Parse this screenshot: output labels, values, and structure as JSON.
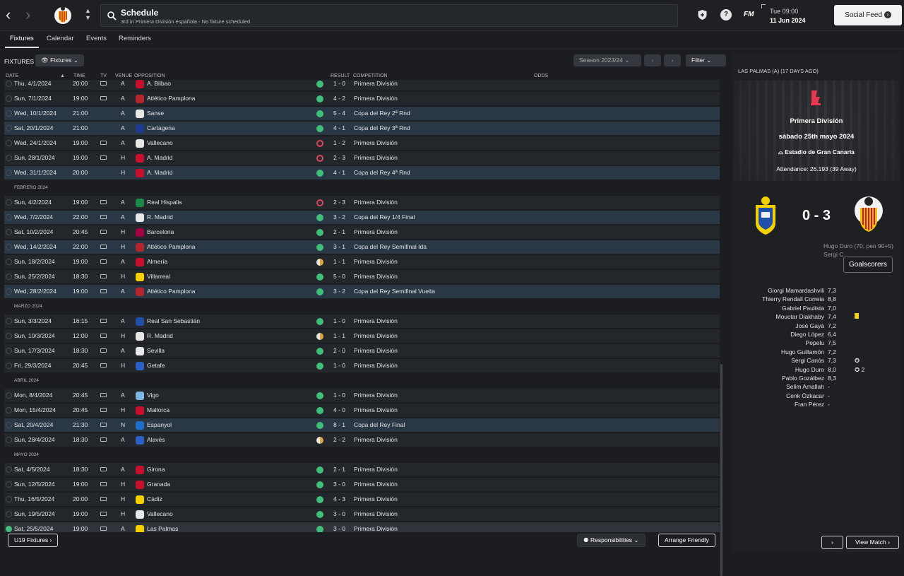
{
  "nav": {
    "back": "‹",
    "forward": "›"
  },
  "search": {
    "title": "Schedule",
    "subtitle": "3rd in Primera División española - No fixture scheduled."
  },
  "datetime": {
    "time": "Tue 09:00",
    "date": "11 Jun 2024"
  },
  "fm_label": "FM",
  "social_feed": "Social Feed",
  "tabs": [
    "Fixtures",
    "Calendar",
    "Events",
    "Reminders"
  ],
  "fixtures_label": "FIXTURES",
  "fixtures_filter": "Fixtures",
  "season": "Season 2023/24",
  "filter": "Filter",
  "columns": [
    "DATE",
    "TIME",
    "TV",
    "VENUE",
    "OPPOSITION",
    "RESULT",
    "COMPETITION",
    "ODDS"
  ],
  "colors": {
    "win": "#3fbf7a",
    "loss": "#d9485a",
    "draw": "#e0a63a",
    "highlight": "#2a3845"
  },
  "rows": [
    {
      "date": "Thu, 4/1/2024",
      "time": "20:00",
      "tv": true,
      "venue": "A",
      "opp": "A. Bilbao",
      "result": "1 - 0",
      "r": "w",
      "comp": "Primera División",
      "badge": "#c8102e",
      "hl": false
    },
    {
      "date": "Sun, 7/1/2024",
      "time": "19:00",
      "tv": true,
      "venue": "A",
      "opp": "Atlético Pamplona",
      "result": "4 - 2",
      "r": "w",
      "comp": "Primera División",
      "badge": "#b3262e",
      "hl": false
    },
    {
      "date": "Wed, 10/1/2024",
      "time": "21:00",
      "tv": false,
      "venue": "A",
      "opp": "Sanse",
      "result": "5 - 4",
      "r": "w",
      "comp": "Copa del Rey 2ª Rnd",
      "badge": "#e8e8e8",
      "hl": true
    },
    {
      "date": "Sat, 20/1/2024",
      "time": "21:00",
      "tv": false,
      "venue": "A",
      "opp": "Cartagena",
      "result": "4 - 1",
      "r": "w",
      "comp": "Copa del Rey 3ª Rnd",
      "badge": "#1f3b8f",
      "hl": true
    },
    {
      "date": "Wed, 24/1/2024",
      "time": "19:00",
      "tv": true,
      "venue": "A",
      "opp": "Vallecano",
      "result": "1 - 2",
      "r": "l",
      "comp": "Primera División",
      "badge": "#e8e8e8",
      "hl": false
    },
    {
      "date": "Sun, 28/1/2024",
      "time": "19:00",
      "tv": true,
      "venue": "H",
      "opp": "A. Madrid",
      "result": "2 - 3",
      "r": "l",
      "comp": "Primera División",
      "badge": "#c8102e",
      "hl": false
    },
    {
      "date": "Wed, 31/1/2024",
      "time": "20:00",
      "tv": false,
      "venue": "H",
      "opp": "A. Madrid",
      "result": "4 - 1",
      "r": "w",
      "comp": "Copa del Rey 4ª Rnd",
      "badge": "#c8102e",
      "hl": true
    },
    {
      "month": "FEBRERO 2024"
    },
    {
      "date": "Sun, 4/2/2024",
      "time": "19:00",
      "tv": true,
      "venue": "A",
      "opp": "Real Hispalis",
      "result": "2 - 3",
      "r": "l",
      "comp": "Primera División",
      "badge": "#1a8a4a",
      "hl": false
    },
    {
      "date": "Wed, 7/2/2024",
      "time": "22:00",
      "tv": true,
      "venue": "A",
      "opp": "R. Madrid",
      "result": "3 - 2",
      "r": "w",
      "comp": "Copa del Rey 1/4 Final",
      "badge": "#e8e8e8",
      "hl": true
    },
    {
      "date": "Sat, 10/2/2024",
      "time": "20:45",
      "tv": true,
      "venue": "H",
      "opp": "Barcelona",
      "result": "2 - 1",
      "r": "w",
      "comp": "Primera División",
      "badge": "#a50044",
      "hl": false
    },
    {
      "date": "Wed, 14/2/2024",
      "time": "22:00",
      "tv": true,
      "venue": "H",
      "opp": "Atlético Pamplona",
      "result": "3 - 1",
      "r": "w",
      "comp": "Copa del Rey Semifinal Ida",
      "badge": "#b3262e",
      "hl": true
    },
    {
      "date": "Sun, 18/2/2024",
      "time": "19:00",
      "tv": true,
      "venue": "A",
      "opp": "Almería",
      "result": "1 - 1",
      "r": "d",
      "comp": "Primera División",
      "badge": "#c8102e",
      "hl": false
    },
    {
      "date": "Sun, 25/2/2024",
      "time": "18:30",
      "tv": true,
      "venue": "H",
      "opp": "Villarreal",
      "result": "5 - 0",
      "r": "w",
      "comp": "Primera División",
      "badge": "#f5d000",
      "hl": false
    },
    {
      "date": "Wed, 28/2/2024",
      "time": "19:00",
      "tv": true,
      "venue": "A",
      "opp": "Atlético Pamplona",
      "result": "3 - 2",
      "r": "w",
      "comp": "Copa del Rey Semifinal Vuelta",
      "badge": "#b3262e",
      "hl": true
    },
    {
      "month": "MARZO 2024"
    },
    {
      "date": "Sun, 3/3/2024",
      "time": "16:15",
      "tv": true,
      "venue": "A",
      "opp": "Real San Sebastián",
      "result": "1 - 0",
      "r": "w",
      "comp": "Primera División",
      "badge": "#1f4fa8",
      "hl": false
    },
    {
      "date": "Sun, 10/3/2024",
      "time": "12:00",
      "tv": true,
      "venue": "H",
      "opp": "R. Madrid",
      "result": "1 - 1",
      "r": "d",
      "comp": "Primera División",
      "badge": "#e8e8e8",
      "hl": false
    },
    {
      "date": "Sun, 17/3/2024",
      "time": "18:30",
      "tv": true,
      "venue": "A",
      "opp": "Sevilla",
      "result": "2 - 0",
      "r": "w",
      "comp": "Primera División",
      "badge": "#e8e8e8",
      "hl": false
    },
    {
      "date": "Fri, 29/3/2024",
      "time": "20:45",
      "tv": true,
      "venue": "H",
      "opp": "Getafe",
      "result": "1 - 0",
      "r": "w",
      "comp": "Primera División",
      "badge": "#2a60c8",
      "hl": false
    },
    {
      "month": "ABRIL 2024"
    },
    {
      "date": "Mon, 8/4/2024",
      "time": "20:45",
      "tv": true,
      "venue": "A",
      "opp": "Vigo",
      "result": "1 - 0",
      "r": "w",
      "comp": "Primera División",
      "badge": "#7bb8e0",
      "hl": false
    },
    {
      "date": "Mon, 15/4/2024",
      "time": "20:45",
      "tv": true,
      "venue": "H",
      "opp": "Mallorca",
      "result": "4 - 0",
      "r": "w",
      "comp": "Primera División",
      "badge": "#c8102e",
      "hl": false
    },
    {
      "date": "Sat, 20/4/2024",
      "time": "21:30",
      "tv": true,
      "venue": "N",
      "opp": "Espanyol",
      "result": "8 - 1",
      "r": "w",
      "comp": "Copa del Rey Final",
      "badge": "#1f6fc8",
      "hl": true
    },
    {
      "date": "Sun, 28/4/2024",
      "time": "18:30",
      "tv": true,
      "venue": "A",
      "opp": "Alavés",
      "result": "2 - 2",
      "r": "d",
      "comp": "Primera División",
      "badge": "#2a60c8",
      "hl": false
    },
    {
      "month": "MAYO 2024"
    },
    {
      "date": "Sat, 4/5/2024",
      "time": "18:30",
      "tv": true,
      "venue": "A",
      "opp": "Girona",
      "result": "2 - 1",
      "r": "w",
      "comp": "Primera División",
      "badge": "#c8102e",
      "hl": false
    },
    {
      "date": "Sun, 12/5/2024",
      "time": "19:00",
      "tv": true,
      "venue": "H",
      "opp": "Granada",
      "result": "3 - 0",
      "r": "w",
      "comp": "Primera División",
      "badge": "#c8102e",
      "hl": false
    },
    {
      "date": "Thu, 16/5/2024",
      "time": "20:00",
      "tv": true,
      "venue": "H",
      "opp": "Cádiz",
      "result": "4 - 3",
      "r": "w",
      "comp": "Primera División",
      "badge": "#f5d000",
      "hl": false
    },
    {
      "date": "Sun, 19/5/2024",
      "time": "19:00",
      "tv": true,
      "venue": "H",
      "opp": "Vallecano",
      "result": "3 - 0",
      "r": "w",
      "comp": "Primera División",
      "badge": "#e8e8e8",
      "hl": false
    },
    {
      "date": "Sat, 25/5/2024",
      "time": "19:00",
      "tv": true,
      "venue": "A",
      "opp": "Las Palmas",
      "result": "3 - 0",
      "r": "w",
      "comp": "Primera División",
      "badge": "#f5d000",
      "hl": false,
      "last": true
    }
  ],
  "bottom": {
    "u19": "U19 Fixtures",
    "responsibilities": "Responsibilities",
    "arrange": "Arrange Friendly"
  },
  "panel": {
    "header": "LAS PALMAS (A) (17 DAYS AGO)",
    "competition": "Primera División",
    "date": "sábado 25th mayo 2024",
    "stadium": "Estadio de Gran Canaria",
    "attendance": "Attendance: 26.193 (39 Away)",
    "score": "0 - 3",
    "scorer1": "Hugo Duro (70, pen 90+5)",
    "scorer2": "Sergi C",
    "tooltip": "Goalscorers",
    "view_match": "View Match",
    "next": "›",
    "players": [
      {
        "name": "Giorgi Mamardashvili",
        "rating": "7,3",
        "extra": ""
      },
      {
        "name": "Thierry Rendall Correia",
        "rating": "8,8",
        "extra": ""
      },
      {
        "name": "Gabriel Paulista",
        "rating": "7,0",
        "extra": ""
      },
      {
        "name": "Mouctar Diakhaby",
        "rating": "7,4",
        "extra": "yellow"
      },
      {
        "name": "José Gayà",
        "rating": "7,2",
        "extra": ""
      },
      {
        "name": "Diego López",
        "rating": "6,4",
        "extra": ""
      },
      {
        "name": "Pepelu",
        "rating": "7,5",
        "extra": ""
      },
      {
        "name": "Hugo Guillamón",
        "rating": "7,2",
        "extra": ""
      },
      {
        "name": "Sergi Canós",
        "rating": "7,3",
        "extra": "ball"
      },
      {
        "name": "Hugo Duro",
        "rating": "8,0",
        "extra": "ball2"
      },
      {
        "name": "Pablo Gozálbez",
        "rating": "8,3",
        "extra": ""
      },
      {
        "name": "Selim Amallah",
        "rating": "-",
        "extra": ""
      },
      {
        "name": "Cenk Özkacar",
        "rating": "-",
        "extra": ""
      },
      {
        "name": "Fran Pérez",
        "rating": "-",
        "extra": ""
      }
    ],
    "goal_count": "2"
  }
}
